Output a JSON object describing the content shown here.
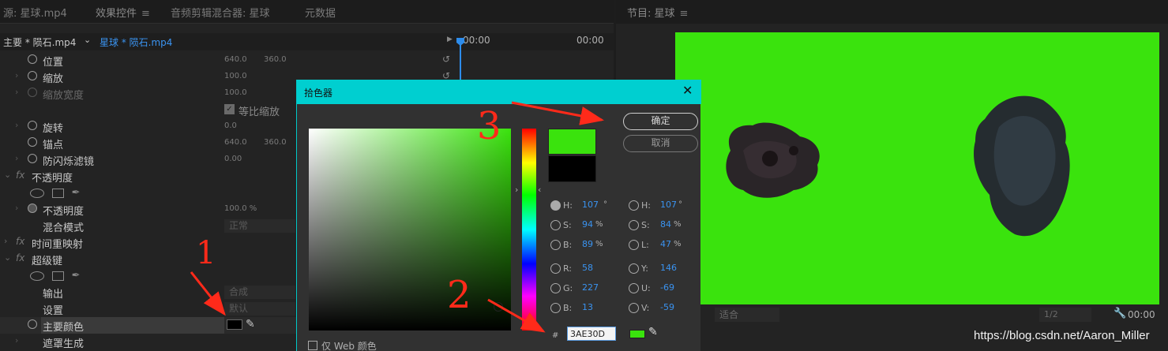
{
  "left_panel": {
    "tabs": [
      {
        "label": "源: 星球.mp4"
      },
      {
        "label": "效果控件"
      },
      {
        "label": "音频剪辑混合器: 星球"
      },
      {
        "label": "元数据"
      }
    ],
    "tab_menu": "≡",
    "clip_master": "主要 * 陨石.mp4",
    "clip_current": "星球 * 陨石.mp4",
    "time_start": "00:00",
    "time_end": "00:00",
    "properties": [
      {
        "label": "位置",
        "v1": "640.0",
        "v2": "360.0"
      },
      {
        "label": "缩放",
        "v1": "100.0"
      },
      {
        "label": "缩放宽度",
        "v1": "100.0"
      },
      {
        "label": "旋转",
        "v1": "0.0"
      },
      {
        "label": "锚点",
        "v1": "640.0",
        "v2": "360.0"
      },
      {
        "label": "防闪烁滤镜",
        "v1": "0.00"
      }
    ],
    "uniform_scale": "等比缩放",
    "opacity_section": "不透明度",
    "opacity_label": "不透明度",
    "opacity_value": "100.0 %",
    "blend_mode_label": "混合模式",
    "blend_mode_value": "正常",
    "time_remap": "时间重映射",
    "ultra_key": "超级键",
    "output_label": "输出",
    "output_value": "合成",
    "setting_label": "设置",
    "setting_value": "默认",
    "key_color_label": "主要颜色",
    "matte_gen_label": "遮罩生成"
  },
  "right_panel": {
    "tab": "节目: 星球",
    "tab_menu": "≡",
    "fit_value": "适合",
    "ratio_value": "1/2",
    "time": "00:00"
  },
  "dialog": {
    "title": "拾色器",
    "ok_label": "确定",
    "cancel_label": "取消",
    "hsb": [
      {
        "label": "H:",
        "value": "107",
        "unit": "°",
        "selected": true
      },
      {
        "label": "S:",
        "value": "94",
        "unit": "%",
        "selected": false
      },
      {
        "label": "B:",
        "value": "89",
        "unit": "%",
        "selected": false
      }
    ],
    "hsl": [
      {
        "label": "H:",
        "value": "107",
        "unit": "°"
      },
      {
        "label": "S:",
        "value": "84",
        "unit": "%"
      },
      {
        "label": "L:",
        "value": "47",
        "unit": "%"
      }
    ],
    "rgb": [
      {
        "label": "R:",
        "value": "58"
      },
      {
        "label": "G:",
        "value": "227"
      },
      {
        "label": "B:",
        "value": "13"
      }
    ],
    "yuv": [
      {
        "label": "Y:",
        "value": "146"
      },
      {
        "label": "U:",
        "value": "-69"
      },
      {
        "label": "V:",
        "value": "-59"
      }
    ],
    "hash": "#",
    "hex": "3AE30D",
    "web_only_label": "仅 Web 颜色",
    "current_color": "#3ae30d"
  },
  "annotations": {
    "num1": "1",
    "num2": "2",
    "num3": "3",
    "color": "#ff2a1a"
  },
  "watermark": "https://blog.csdn.net/Aaron_Miller"
}
